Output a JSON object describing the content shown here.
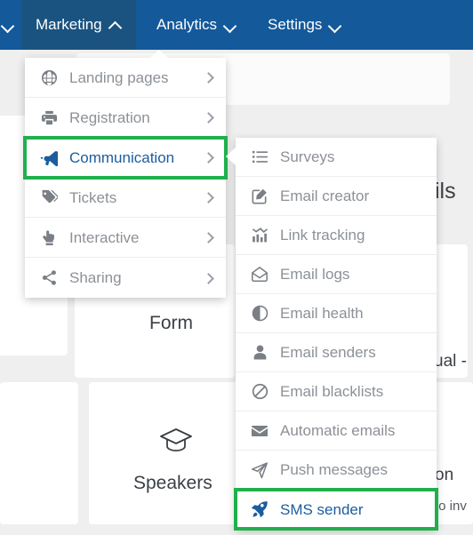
{
  "colors": {
    "nav_bg": "#14599a",
    "nav_active_bg": "#1a5380",
    "menu_bg": "#ffffff",
    "menu_text": "#8c9197",
    "highlight_border": "#1fb04c",
    "highlight_text": "#1b5e9e",
    "page_bg": "#efefef"
  },
  "topnav": {
    "items": [
      {
        "label": "Marketing",
        "caret": "chevron-up-icon",
        "active": true
      },
      {
        "label": "Analytics",
        "caret": "chevron-down-icon",
        "active": false
      },
      {
        "label": "Settings",
        "caret": "chevron-down-icon",
        "active": false
      }
    ]
  },
  "menu_primary": {
    "items": [
      {
        "label": "Landing pages",
        "icon": "globe-icon",
        "has_submenu": true,
        "highlighted": false
      },
      {
        "label": "Registration",
        "icon": "printer-icon",
        "has_submenu": true,
        "highlighted": false
      },
      {
        "label": "Communication",
        "icon": "megaphone-icon",
        "has_submenu": true,
        "highlighted": true
      },
      {
        "label": "Tickets",
        "icon": "tags-icon",
        "has_submenu": true,
        "highlighted": false
      },
      {
        "label": "Interactive",
        "icon": "pointing-hand-icon",
        "has_submenu": true,
        "highlighted": false
      },
      {
        "label": "Sharing",
        "icon": "share-nodes-icon",
        "has_submenu": true,
        "highlighted": false
      }
    ]
  },
  "menu_secondary": {
    "items": [
      {
        "label": "Surveys",
        "icon": "list-icon",
        "highlighted": false
      },
      {
        "label": "Email creator",
        "icon": "pencil-square-icon",
        "highlighted": false
      },
      {
        "label": "Link tracking",
        "icon": "bar-chart-icon",
        "highlighted": false
      },
      {
        "label": "Email logs",
        "icon": "open-envelope-icon",
        "highlighted": false
      },
      {
        "label": "Email health",
        "icon": "half-circle-icon",
        "highlighted": false
      },
      {
        "label": "Email senders",
        "icon": "person-icon",
        "highlighted": false
      },
      {
        "label": "Email blacklists",
        "icon": "ban-icon",
        "highlighted": false
      },
      {
        "label": "Automatic emails",
        "icon": "envelope-icon",
        "highlighted": false
      },
      {
        "label": "Push messages",
        "icon": "paper-plane-icon",
        "highlighted": false
      },
      {
        "label": "SMS sender",
        "icon": "rocket-icon",
        "highlighted": true
      }
    ]
  },
  "background": {
    "cards": [
      {
        "label": "Form",
        "icon": ""
      },
      {
        "label": "Speakers",
        "icon": "graduation-cap-icon"
      }
    ],
    "text_fragments": [
      {
        "text": "ils"
      },
      {
        "text": "ual -"
      },
      {
        "text": "on"
      },
      {
        "text": "to inv"
      }
    ]
  }
}
